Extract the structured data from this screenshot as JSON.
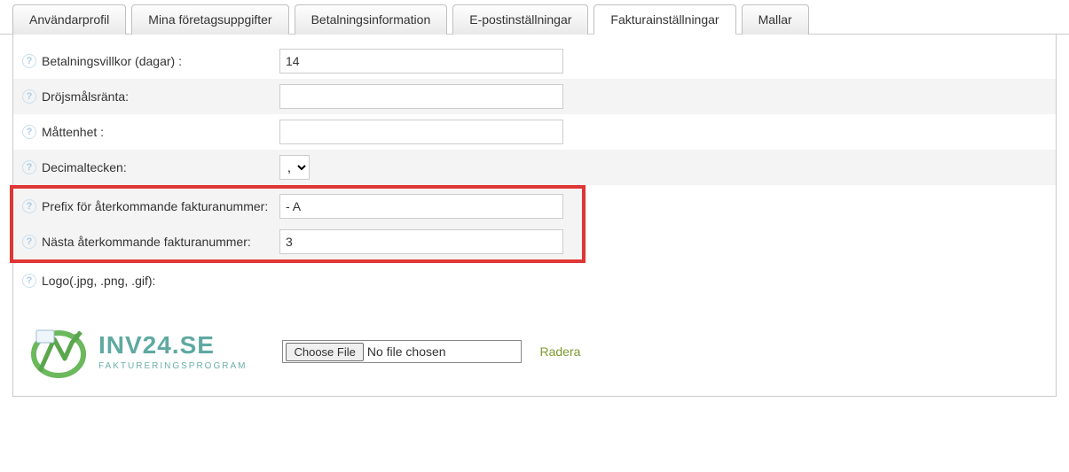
{
  "tabs": [
    {
      "label": "Användarprofil",
      "active": false
    },
    {
      "label": "Mina företagsuppgifter",
      "active": false
    },
    {
      "label": "Betalningsinformation",
      "active": false
    },
    {
      "label": "E-postinställningar",
      "active": false
    },
    {
      "label": "Fakturainställningar",
      "active": true
    },
    {
      "label": "Mallar",
      "active": false
    }
  ],
  "fields": {
    "payment_terms": {
      "label": "Betalningsvillkor (dagar) :",
      "value": "14"
    },
    "late_interest": {
      "label": "Dröjsmålsränta:",
      "value": ""
    },
    "unit": {
      "label": "Måttenhet :",
      "value": ""
    },
    "decimal_sep": {
      "label": "Decimaltecken:",
      "selected": ",",
      "options": [
        ","
      ]
    },
    "prefix": {
      "label": "Prefix för återkommande fakturanummer:",
      "value": "- A"
    },
    "next_number": {
      "label": "Nästa återkommande fakturanummer:",
      "value": "3"
    },
    "logo_label": {
      "label": "Logo(.jpg, .png, .gif):"
    }
  },
  "file_input": {
    "button": "Choose File",
    "status": "No file chosen",
    "delete": "Radera"
  },
  "logo": {
    "title": "INV24.SE",
    "subtitle": "FAKTURERINGSPROGRAM"
  },
  "help_glyph": "?"
}
